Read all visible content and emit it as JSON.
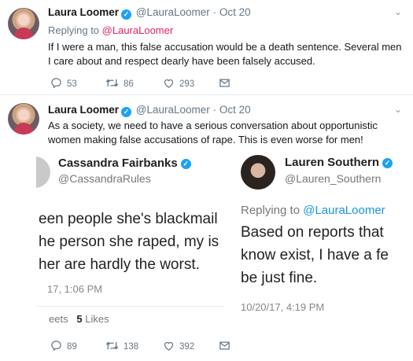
{
  "colors": {
    "accent": "#1da1f2",
    "reply_link": "#e0245e",
    "muted": "#657786"
  },
  "tweets": [
    {
      "name": "Laura Loomer",
      "handle": "@LauraLoomer",
      "sep": "·",
      "date": "Oct 20",
      "replying_prefix": "Replying to",
      "replying_to": "@LauraLoomer",
      "text": "If I were a man, this false accusation would be a death sentence. Several men I care about and respect dearly have been falsely accused.",
      "actions": {
        "replies": "53",
        "retweets": "86",
        "likes": "293"
      }
    },
    {
      "name": "Laura Loomer",
      "handle": "@LauraLoomer",
      "sep": "·",
      "date": "Oct 20",
      "text": "As a society, we need to have a serious conversation about opportunistic women making false accusations of rape. This is even worse for men!",
      "actions": {
        "replies": "89",
        "retweets": "138",
        "likes": "392"
      },
      "media": {
        "left": {
          "name": "Cassandra Fairbanks",
          "handle": "@CassandraRules",
          "lines": [
            "een people she's blackmail",
            "he person she raped, my is",
            "her are hardly the worst."
          ],
          "time": "17, 1:06 PM",
          "stats_prefix": "eets",
          "likes_count": "5",
          "likes_label": "Likes"
        },
        "right": {
          "name": "Lauren Southern",
          "handle": "@Lauren_Southern",
          "replying_prefix": "Replying to",
          "replying_to": "@LauraLoomer",
          "lines": [
            "Based on reports that",
            "know exist, I have a fe",
            "be just fine."
          ],
          "time": "10/20/17, 4:19 PM"
        }
      }
    }
  ]
}
